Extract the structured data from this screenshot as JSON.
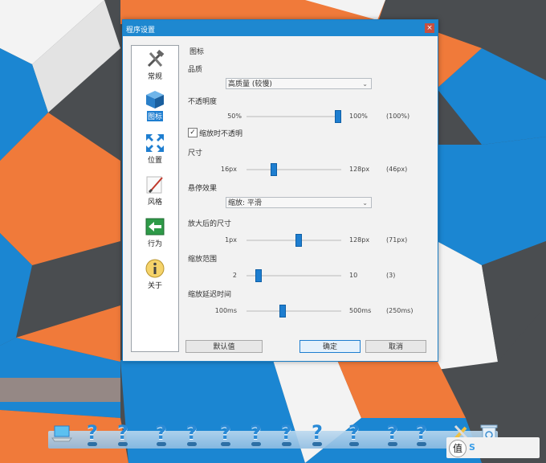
{
  "dialog": {
    "title": "程序设置",
    "close_label": "×"
  },
  "sidebar": {
    "items": [
      {
        "label": "常规",
        "icon": "tools-icon"
      },
      {
        "label": "图标",
        "icon": "cube-icon"
      },
      {
        "label": "位置",
        "icon": "arrows-icon"
      },
      {
        "label": "风格",
        "icon": "brush-icon"
      },
      {
        "label": "行为",
        "icon": "arrow-left-icon"
      },
      {
        "label": "关于",
        "icon": "info-icon"
      }
    ]
  },
  "icon_panel": {
    "section_title": "图标",
    "quality_label": "品质",
    "quality_value": "高质量 (较慢)",
    "opacity_label": "不透明度",
    "opacity": {
      "min": "50%",
      "max": "100%",
      "value": "(100%)",
      "fraction": 1.0
    },
    "opaque_on_zoom_label": "缩放时不透明",
    "opaque_on_zoom_checked": true,
    "size_label": "尺寸",
    "size": {
      "min": "16px",
      "max": "128px",
      "value": "(46px)",
      "fraction": 0.27
    },
    "hover_effect_label": "悬停效果",
    "hover_effect_value": "缩放: 平滑",
    "zoom_size_label": "放大后的尺寸",
    "zoom_size": {
      "min": "1px",
      "max": "128px",
      "value": "(71px)",
      "fraction": 0.55
    },
    "zoom_range_label": "缩放范围",
    "zoom_range": {
      "min": "2",
      "max": "10",
      "value": "(3)",
      "fraction": 0.1
    },
    "zoom_delay_label": "缩放延迟时间",
    "zoom_delay": {
      "min": "100ms",
      "max": "500ms",
      "value": "(250ms)",
      "fraction": 0.375
    }
  },
  "buttons": {
    "default": "默认值",
    "ok": "确定",
    "cancel": "取消"
  },
  "dock": {
    "items": [
      "laptop-icon",
      "question-icon",
      "question-icon",
      "question-icon",
      "question-icon",
      "question-icon",
      "question-icon",
      "question-icon",
      "question-icon",
      "question-icon",
      "question-icon",
      "question-icon",
      "tools-icon",
      "recycle-bin-icon"
    ],
    "question_glyph": "?"
  },
  "watermark": {
    "glyph": "值",
    "text": "S"
  },
  "colors": {
    "accent": "#1e7ed0",
    "desktop_orange": "#f07a3a",
    "desktop_blue": "#1b86d2",
    "desktop_dark": "#4a4d50"
  }
}
